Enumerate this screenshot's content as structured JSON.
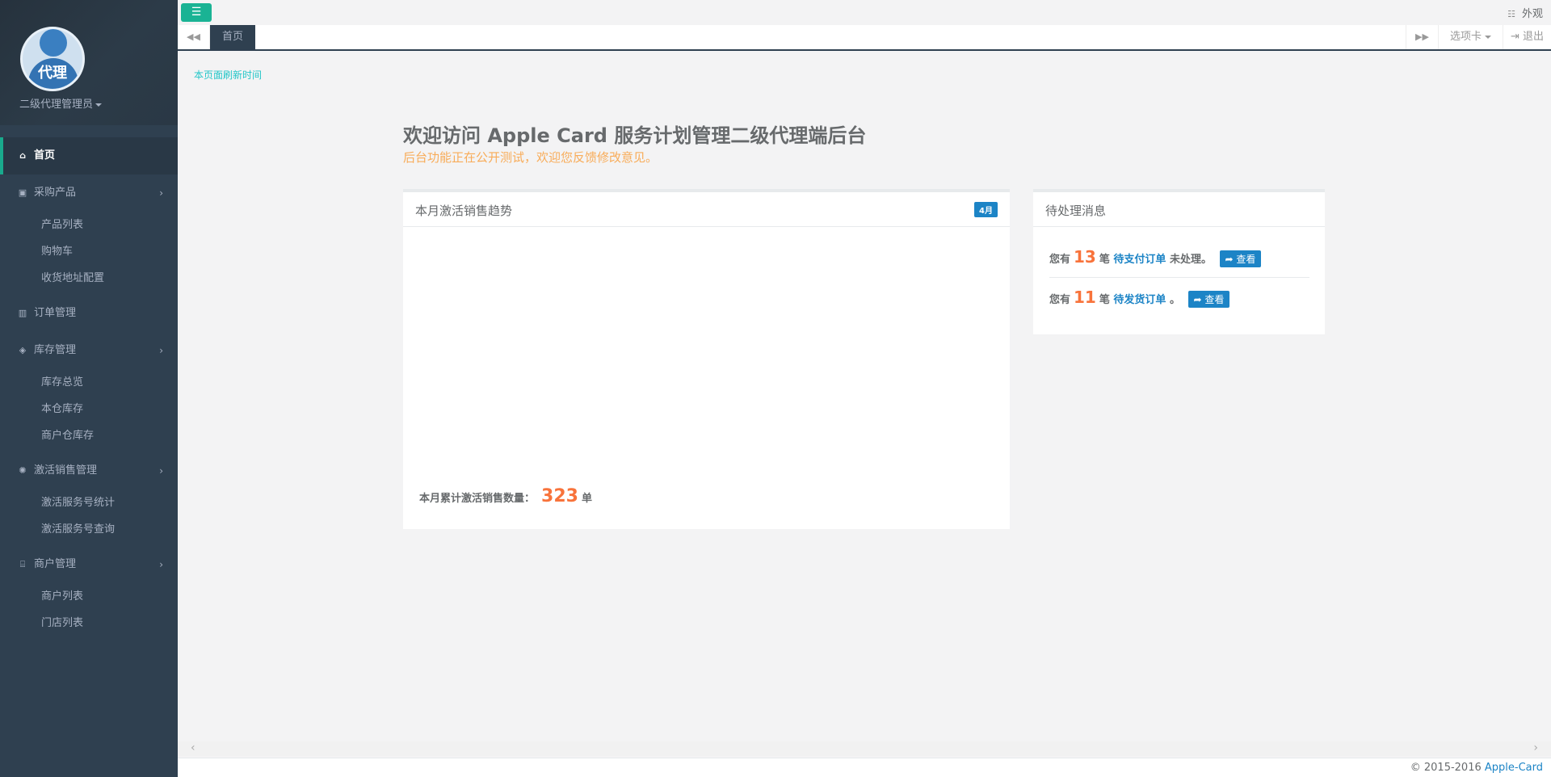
{
  "sidebar": {
    "avatar_text": "代理",
    "role": "二级代理管理员",
    "menu": [
      {
        "label": "首页",
        "icon": "home-icon",
        "active": true
      },
      {
        "label": "采购产品",
        "icon": "gift-icon",
        "children": [
          "产品列表",
          "购物车",
          "收货地址配置"
        ]
      },
      {
        "label": "订单管理",
        "icon": "columns-icon"
      },
      {
        "label": "库存管理",
        "icon": "dropbox-icon",
        "children": [
          "库存总览",
          "本仓库存",
          "商户仓库存"
        ]
      },
      {
        "label": "激活销售管理",
        "icon": "spinner-icon",
        "children": [
          "激活服务号统计",
          "激活服务号查询"
        ]
      },
      {
        "label": "商户管理",
        "icon": "bank-icon",
        "children": [
          "商户列表",
          "门店列表"
        ]
      }
    ]
  },
  "topbar": {
    "appearance_label": "外观"
  },
  "tabs": {
    "home_label": "首页",
    "options_label": "选项卡",
    "logout_label": "退出"
  },
  "content": {
    "refresh_label": "本页面刷新时间",
    "welcome_title": "欢迎访问 Apple Card 服务计划管理二级代理端后台",
    "welcome_sub": "后台功能正在公开测试，欢迎您反馈修改意见。"
  },
  "sales_panel": {
    "title": "本月激活销售趋势",
    "badge": "4月",
    "total_label": "本月累计激活销售数量：",
    "total_value": "323",
    "total_unit": "单"
  },
  "messages_panel": {
    "title": "待处理消息",
    "rows": [
      {
        "prefix": "您有",
        "count": "13",
        "unit": "笔",
        "link": "待支付订单",
        "suffix": "未处理。",
        "button": "查看"
      },
      {
        "prefix": "您有",
        "count": "11",
        "unit": "笔",
        "link": "待发货订单",
        "suffix": "。",
        "button": "查看"
      }
    ]
  },
  "footer": {
    "copyright": "© 2015-2016",
    "brand": "Apple-Card"
  },
  "colors": {
    "sidebar_bg": "#2f4050",
    "accent_green": "#1ab394",
    "link_blue": "#1c84c6",
    "number_orange": "#f8733b",
    "subtitle_orange": "#f8ac59"
  }
}
